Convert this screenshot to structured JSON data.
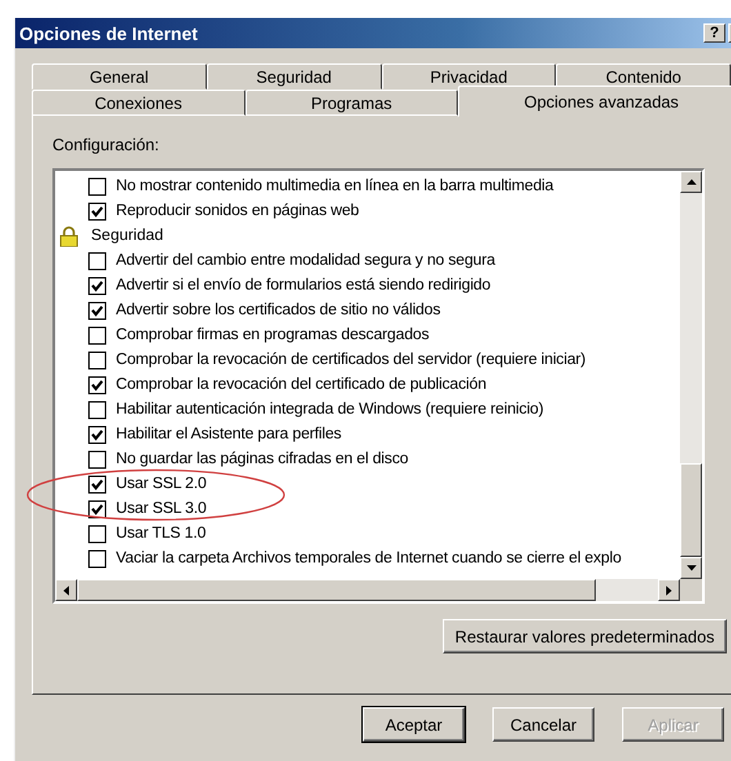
{
  "window": {
    "title": "Opciones de Internet",
    "help_button": "?"
  },
  "tab_rows": [
    [
      {
        "label": "General",
        "selected": false
      },
      {
        "label": "Seguridad",
        "selected": false
      },
      {
        "label": "Privacidad",
        "selected": false
      },
      {
        "label": "Contenido",
        "selected": false
      }
    ],
    [
      {
        "label": "Conexiones",
        "selected": false
      },
      {
        "label": "Programas",
        "selected": false
      },
      {
        "label": "Opciones avanzadas",
        "selected": true
      }
    ]
  ],
  "settings": {
    "label": "Configuración:",
    "items": [
      {
        "kind": "checkbox",
        "label": "No mostrar contenido multimedia en línea en la barra multimedia",
        "checked": false
      },
      {
        "kind": "checkbox",
        "label": "Reproducir sonidos en páginas web",
        "checked": true
      },
      {
        "kind": "group",
        "label": "Seguridad"
      },
      {
        "kind": "checkbox",
        "label": "Advertir del cambio entre modalidad segura y no segura",
        "checked": false
      },
      {
        "kind": "checkbox",
        "label": "Advertir si el envío de formularios está siendo redirigido",
        "checked": true
      },
      {
        "kind": "checkbox",
        "label": "Advertir sobre los certificados de sitio no válidos",
        "checked": true
      },
      {
        "kind": "checkbox",
        "label": "Comprobar firmas en programas descargados",
        "checked": false
      },
      {
        "kind": "checkbox",
        "label": "Comprobar la revocación de certificados del servidor (requiere iniciar)",
        "checked": false
      },
      {
        "kind": "checkbox",
        "label": "Comprobar la revocación del certificado de publicación",
        "checked": true
      },
      {
        "kind": "checkbox",
        "label": "Habilitar autenticación integrada de Windows (requiere reinicio)",
        "checked": false
      },
      {
        "kind": "checkbox",
        "label": "Habilitar el Asistente para perfiles",
        "checked": true
      },
      {
        "kind": "checkbox",
        "label": "No guardar las páginas cifradas en el disco",
        "checked": false
      },
      {
        "kind": "checkbox",
        "label": "Usar SSL 2.0",
        "checked": true
      },
      {
        "kind": "checkbox",
        "label": "Usar SSL 3.0",
        "checked": true
      },
      {
        "kind": "checkbox",
        "label": "Usar TLS 1.0",
        "checked": false
      },
      {
        "kind": "checkbox",
        "label": "Vaciar la carpeta Archivos temporales de Internet cuando se cierre el explo",
        "checked": false
      }
    ],
    "restore_button": "Restaurar valores predeterminados"
  },
  "buttons": [
    {
      "label": "Aceptar",
      "disabled": false,
      "default": true
    },
    {
      "label": "Cancelar",
      "disabled": false,
      "default": false
    },
    {
      "label": "Aplicar",
      "disabled": true,
      "default": false
    }
  ]
}
